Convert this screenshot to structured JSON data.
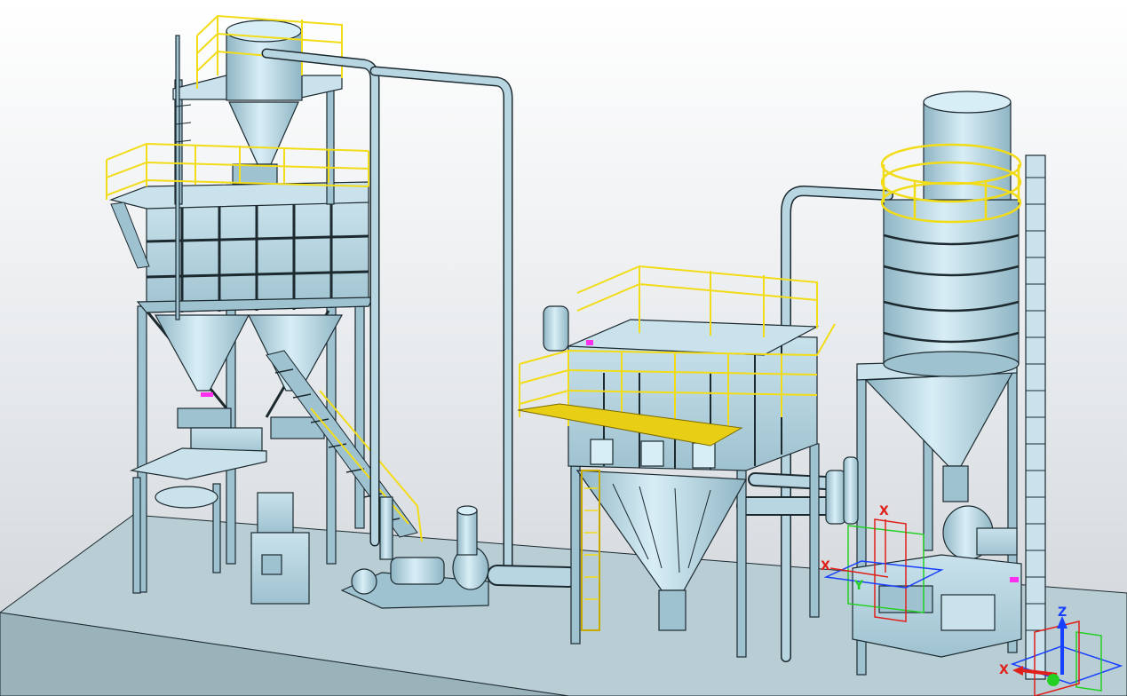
{
  "viewport": {
    "background_top": "#ffffff",
    "background_bottom": "#cfd3d7"
  },
  "colors": {
    "equipment": "#b7d6e2",
    "equipment_dark": "#8fb5c4",
    "outline": "#1c2a30",
    "railing": "#f2dc17",
    "railing_dark": "#c9a800",
    "floor": "#b8cdd4",
    "gizmo_red": "#e0201a",
    "gizmo_green": "#24d024",
    "gizmo_blue": "#1840ff",
    "marker_magenta": "#ff2ff0"
  },
  "gizmos": {
    "center": {
      "x_label": "X",
      "y_label": "Y",
      "z_label": ""
    },
    "left": {
      "x_label": "X",
      "y_label": "",
      "z_label": ""
    },
    "corner": {
      "x_label": "X",
      "y_label": "",
      "z_label": "Z"
    }
  },
  "icons": [
    "move-gizmo-icon",
    "orientation-triad-icon"
  ]
}
